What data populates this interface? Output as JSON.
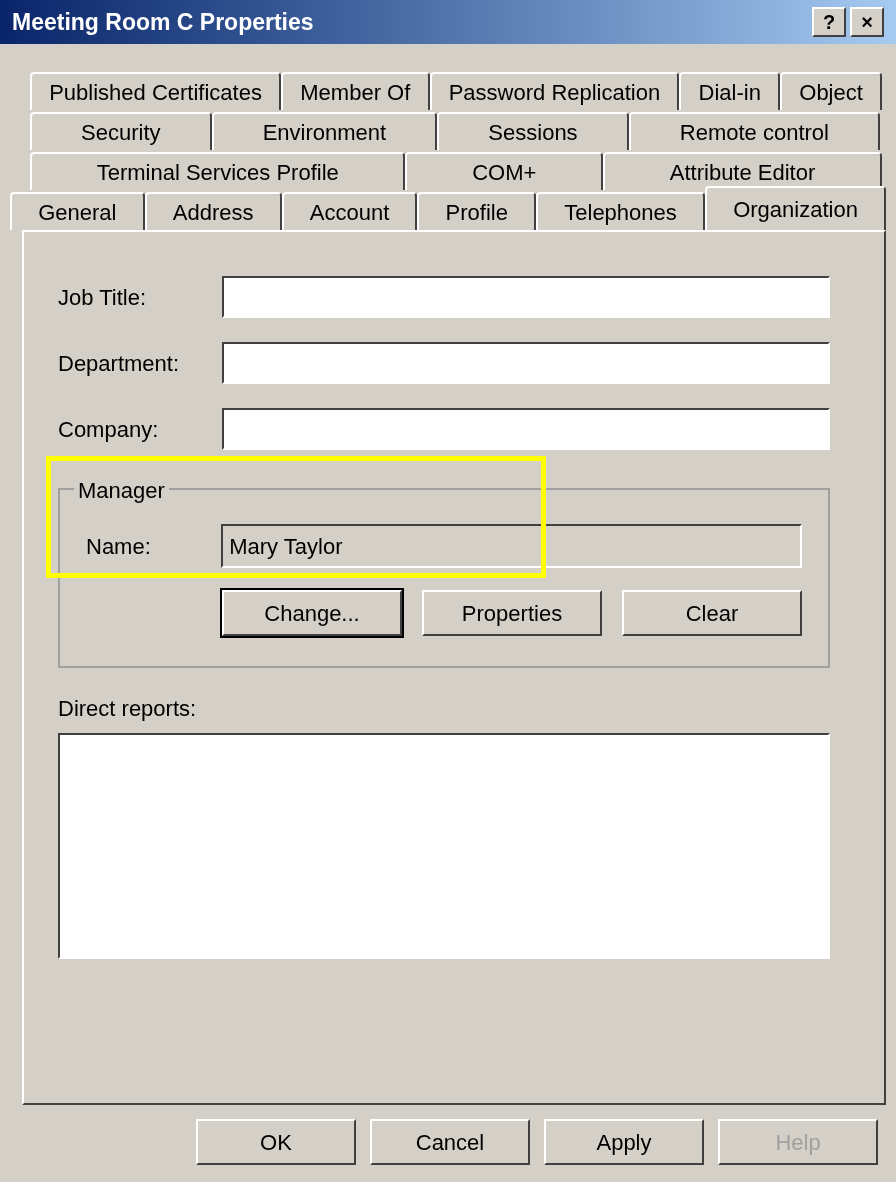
{
  "window": {
    "title": "Meeting Room C Properties",
    "title_buttons": [
      "?",
      "×"
    ]
  },
  "tab_rows": [
    [
      {
        "label": "Published Certificates",
        "selected": false
      },
      {
        "label": "Member Of",
        "selected": false
      },
      {
        "label": "Password Replication",
        "selected": false
      },
      {
        "label": "Dial-in",
        "selected": false
      },
      {
        "label": "Object",
        "selected": false
      }
    ],
    [
      {
        "label": "Security",
        "selected": false
      },
      {
        "label": "Environment",
        "selected": false
      },
      {
        "label": "Sessions",
        "selected": false
      },
      {
        "label": "Remote control",
        "selected": false
      }
    ],
    [
      {
        "label": "Terminal Services Profile",
        "selected": false
      },
      {
        "label": "COM+",
        "selected": false
      },
      {
        "label": "Attribute Editor",
        "selected": false
      }
    ],
    [
      {
        "label": "General",
        "selected": false
      },
      {
        "label": "Address",
        "selected": false
      },
      {
        "label": "Account",
        "selected": false
      },
      {
        "label": "Profile",
        "selected": false
      },
      {
        "label": "Telephones",
        "selected": false
      },
      {
        "label": "Organization",
        "selected": true
      }
    ]
  ],
  "fields": [
    {
      "label": "Job Title:"
    },
    {
      "label": "Department:"
    },
    {
      "label": "Company:"
    }
  ],
  "manager": {
    "title": "Manager",
    "name_label": "Name:",
    "name_value": "Mary Taylor",
    "buttons": [
      {
        "label": "Change...",
        "focused": true
      },
      {
        "label": "Properties",
        "focused": false
      },
      {
        "label": "Clear",
        "focused": false
      }
    ]
  },
  "direct_reports": {
    "label": "Direct reports:"
  },
  "annotations": [
    {
      "kind": "rectangle",
      "color": "#ffff00"
    }
  ],
  "buttons": [
    {
      "label": "OK",
      "disabled": false
    },
    {
      "label": "Cancel",
      "disabled": false
    },
    {
      "label": "Apply",
      "disabled": false
    },
    {
      "label": "Help",
      "disabled": true
    }
  ]
}
